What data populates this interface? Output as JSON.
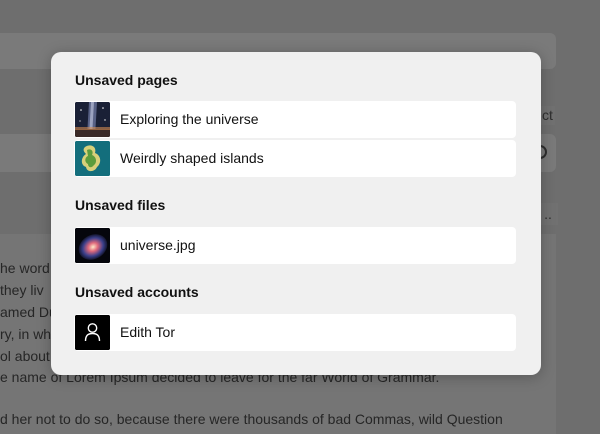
{
  "background": {
    "side_label": "ct",
    "dots": "..",
    "text_lines": [
      "he word",
      " they liv",
      "amed Du",
      "ry, in wh",
      "ol about",
      "e name of Lorem Ipsum decided to leave for the far World of Grammar.",
      "d her not to do so, because there were thousands of bad Commas, wild Question"
    ]
  },
  "modal": {
    "sections": [
      {
        "title": "Unsaved pages",
        "items": [
          {
            "label": "Exploring the universe",
            "thumb": "galaxy-photo"
          },
          {
            "label": "Weirdly shaped islands",
            "thumb": "island-photo"
          }
        ]
      },
      {
        "title": "Unsaved files",
        "items": [
          {
            "label": "universe.jpg",
            "thumb": "nebula-photo"
          }
        ]
      },
      {
        "title": "Unsaved accounts",
        "items": [
          {
            "label": "Edith Tor",
            "thumb": "user-icon"
          }
        ]
      }
    ]
  },
  "colors": {
    "overlay": "#6e6e6e",
    "modal_bg": "#f0f0f0",
    "item_bg": "#ffffff"
  }
}
